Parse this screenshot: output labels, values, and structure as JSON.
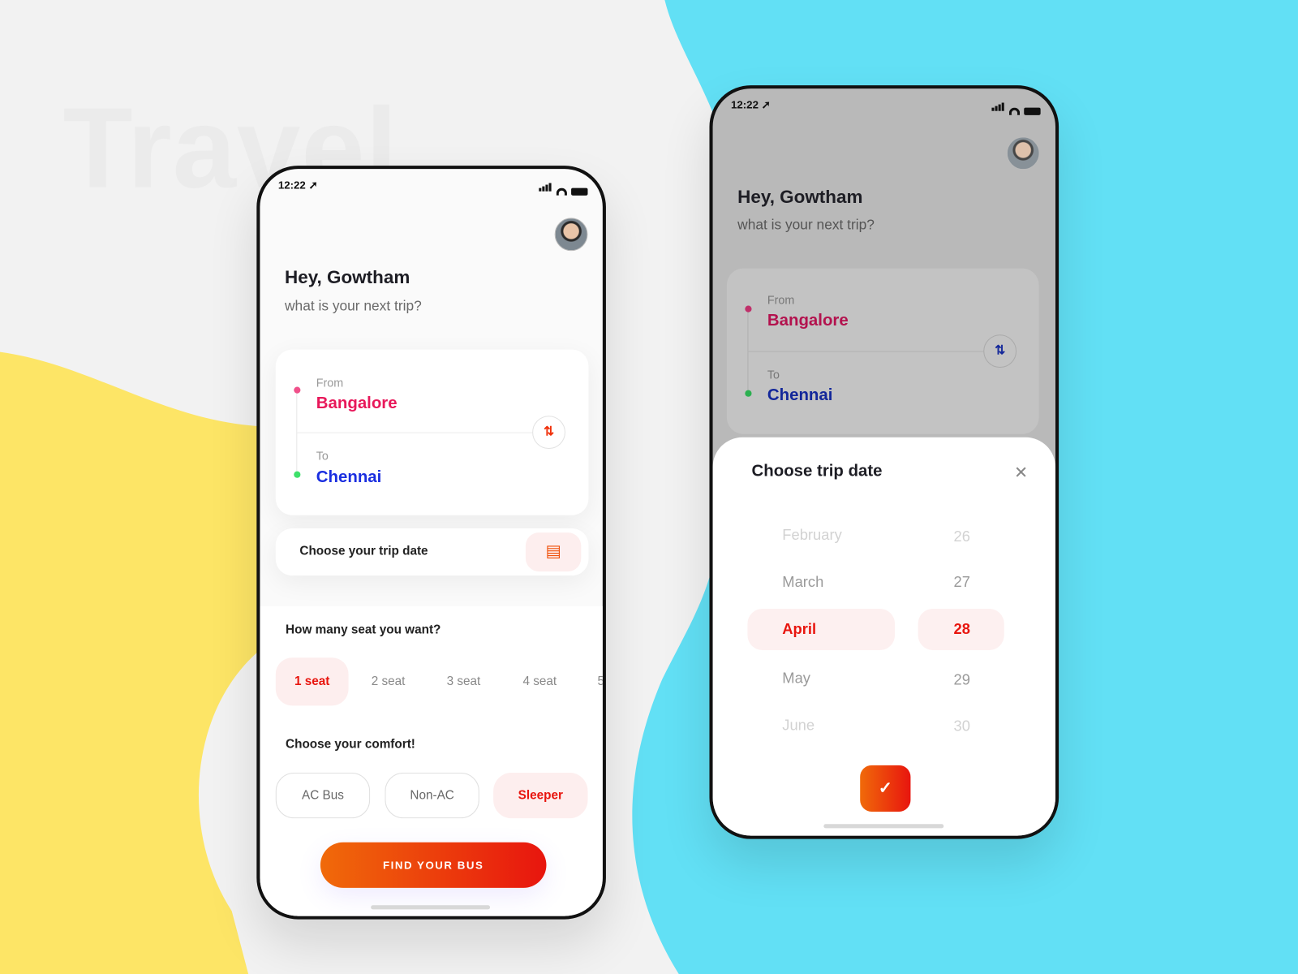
{
  "background": {
    "watermark": "Travel",
    "colors": {
      "yellow": "#fde566",
      "cyan": "#62e0f5",
      "light": "#f2f2f2"
    }
  },
  "accent": {
    "red": "#e8150e",
    "orange": "#f06a0a",
    "from_color": "#e8185a",
    "to_color": "#1a2ee0"
  },
  "home_screen": {
    "status": {
      "time": "12:22",
      "icons": [
        "location-arrow-icon",
        "signal-icon",
        "wifi-icon",
        "battery-icon"
      ]
    },
    "greeting": "Hey, Gowtham",
    "subtitle": "what is your next trip?",
    "route": {
      "from_label": "From",
      "from_city": "Bangalore",
      "to_label": "To",
      "to_city": "Chennai",
      "swap_icon": "swap-arrows-icon"
    },
    "date_field": {
      "label": "Choose your trip date",
      "icon": "calendar-icon"
    },
    "seats": {
      "title": "How many seat you want?",
      "options": [
        "1 seat",
        "2 seat",
        "3 seat",
        "4 seat",
        "5"
      ],
      "selected": "1 seat"
    },
    "comfort": {
      "title": "Choose your comfort!",
      "options": [
        "AC Bus",
        "Non-AC",
        "Sleeper"
      ],
      "selected": "Sleeper"
    },
    "cta": "FIND YOUR BUS"
  },
  "date_screen": {
    "status": {
      "time": "12:22"
    },
    "greeting": "Hey, Gowtham",
    "subtitle": "what is your next trip?",
    "route": {
      "from_label": "From",
      "from_city": "Bangalore",
      "to_label": "To",
      "to_city": "Chennai"
    },
    "sheet": {
      "title": "Choose trip date",
      "close_icon": "close-icon",
      "months": [
        "February",
        "March",
        "April",
        "May",
        "June"
      ],
      "days": [
        "26",
        "27",
        "28",
        "29",
        "30"
      ],
      "selected_month": "April",
      "selected_day": "28",
      "confirm_icon": "check-icon"
    }
  }
}
